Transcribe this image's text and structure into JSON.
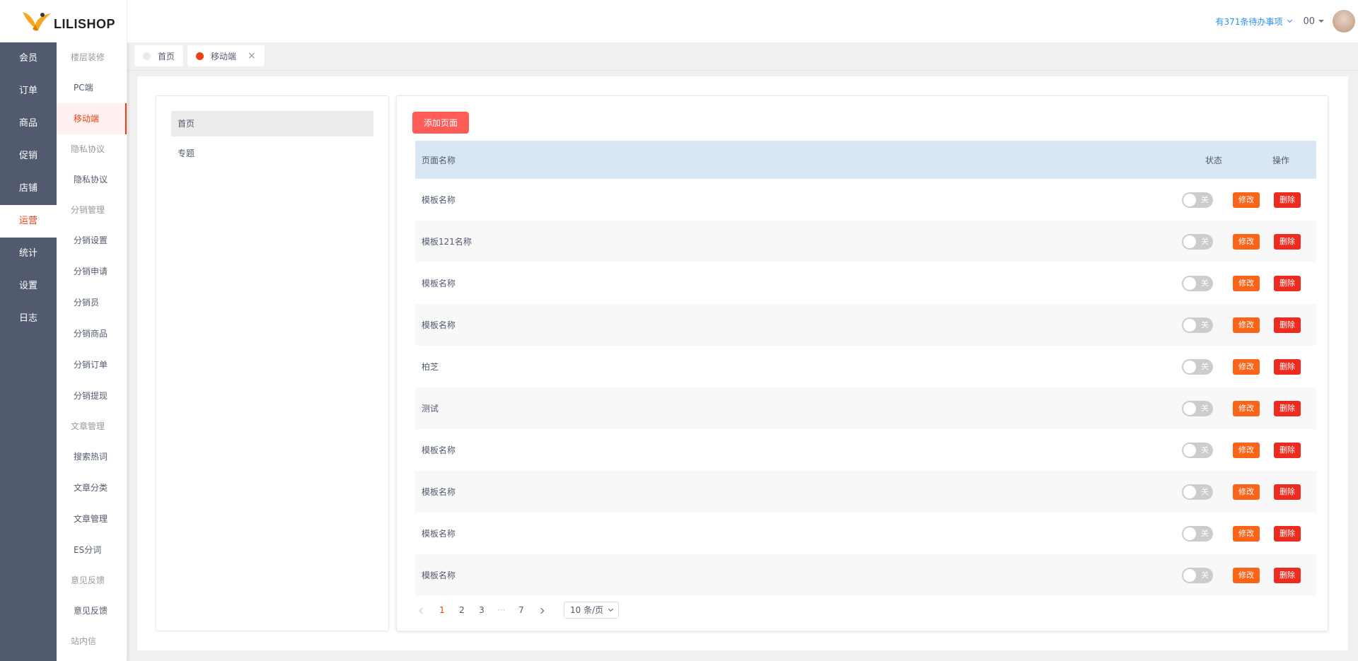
{
  "brand": {
    "name": "LILISHOP",
    "accent": "#ed3f14"
  },
  "rail": {
    "items": [
      {
        "label": "会员"
      },
      {
        "label": "订单"
      },
      {
        "label": "商品"
      },
      {
        "label": "促销"
      },
      {
        "label": "店铺"
      },
      {
        "label": "运营"
      },
      {
        "label": "统计"
      },
      {
        "label": "设置"
      },
      {
        "label": "日志"
      }
    ],
    "active_index": 5
  },
  "submenu": {
    "groups": [
      {
        "title": "楼层装修",
        "items": [
          "PC端",
          "移动端"
        ]
      },
      {
        "title": "隐私协议",
        "items": [
          "隐私协议"
        ]
      },
      {
        "title": "分销管理",
        "items": [
          "分销设置",
          "分销申请",
          "分销员",
          "分销商品",
          "分销订单",
          "分销提现"
        ]
      },
      {
        "title": "文章管理",
        "items": [
          "搜索热词",
          "文章分类",
          "文章管理",
          "ES分词"
        ]
      },
      {
        "title": "意见反馈",
        "items": [
          "意见反馈"
        ]
      },
      {
        "title": "站内信",
        "items": [
          "站内信"
        ]
      }
    ],
    "active_item": "移动端"
  },
  "header": {
    "todo_text": "有371条待办事项",
    "user_name": "00"
  },
  "tabs": [
    {
      "label": "首页",
      "active": false
    },
    {
      "label": "移动端",
      "active": true,
      "close": "×"
    }
  ],
  "left_panel": {
    "items": [
      "首页",
      "专题"
    ]
  },
  "main": {
    "add_button": "添加页面",
    "columns": {
      "name": "页面名称",
      "status": "状态",
      "ops": "操作"
    },
    "rows": [
      {
        "name": "模板名称",
        "status": "关"
      },
      {
        "name": "模板121名称",
        "status": "关"
      },
      {
        "name": "模板名称",
        "status": "关"
      },
      {
        "name": "模板名称",
        "status": "关"
      },
      {
        "name": "柏芝",
        "status": "关"
      },
      {
        "name": "测试",
        "status": "关"
      },
      {
        "name": "模板名称",
        "status": "关"
      },
      {
        "name": "模板名称",
        "status": "关"
      },
      {
        "name": "模板名称",
        "status": "关"
      },
      {
        "name": "模板名称",
        "status": "关"
      }
    ],
    "edit_label": "修改",
    "delete_label": "删除"
  },
  "pagination": {
    "pages": [
      "1",
      "2",
      "3",
      "···",
      "7"
    ],
    "current": "1",
    "page_size": "10 条/页"
  }
}
